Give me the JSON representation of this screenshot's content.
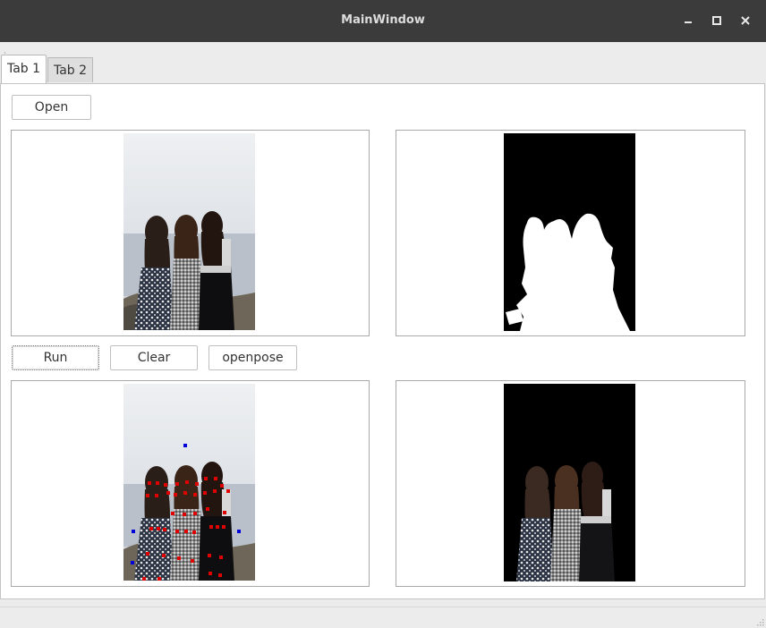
{
  "window": {
    "title": "MainWindow"
  },
  "tabs": [
    {
      "label": "Tab 1"
    },
    {
      "label": "Tab 2"
    }
  ],
  "buttons": {
    "open": "Open",
    "run": "Run",
    "clear": "Clear",
    "openpose": "openpose"
  },
  "colors": {
    "titlebar": "#3b3b3b",
    "keypoint_body": "#e00000",
    "keypoint_extra": "#0000d8",
    "mask": "#000000"
  },
  "icons": {
    "minimize": "minimize-icon",
    "maximize": "maximize-icon",
    "close": "close-icon"
  }
}
